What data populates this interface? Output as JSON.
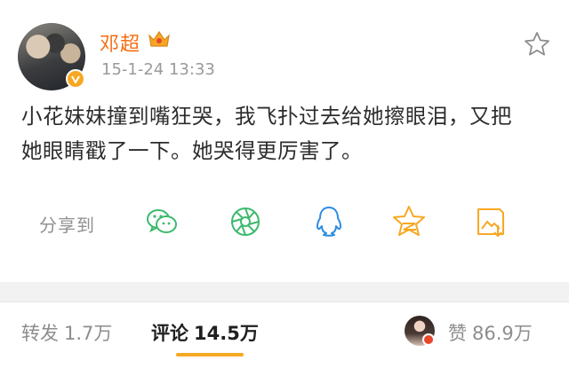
{
  "post": {
    "author": "邓超",
    "timestamp": "15-1-24 13:33",
    "text_line1": "小花妹妹撞到嘴狂哭，我飞扑过去给她擦眼泪，又把",
    "text_line2": "她眼睛戳了一下。她哭得更厉害了。"
  },
  "share": {
    "label": "分享到",
    "icons": [
      "wechat-icon",
      "moments-icon",
      "qq-icon",
      "qzone-icon",
      "save-image-icon"
    ]
  },
  "stats": {
    "repost_label": "转发",
    "repost_count": "1.7万",
    "comment_label": "评论",
    "comment_count": "14.5万",
    "like_label": "赞",
    "like_count": "86.9万"
  },
  "colors": {
    "username": "#f76e12",
    "accent": "#f7a823",
    "share_green": "#3dba6d",
    "share_blue": "#2c8de0"
  }
}
